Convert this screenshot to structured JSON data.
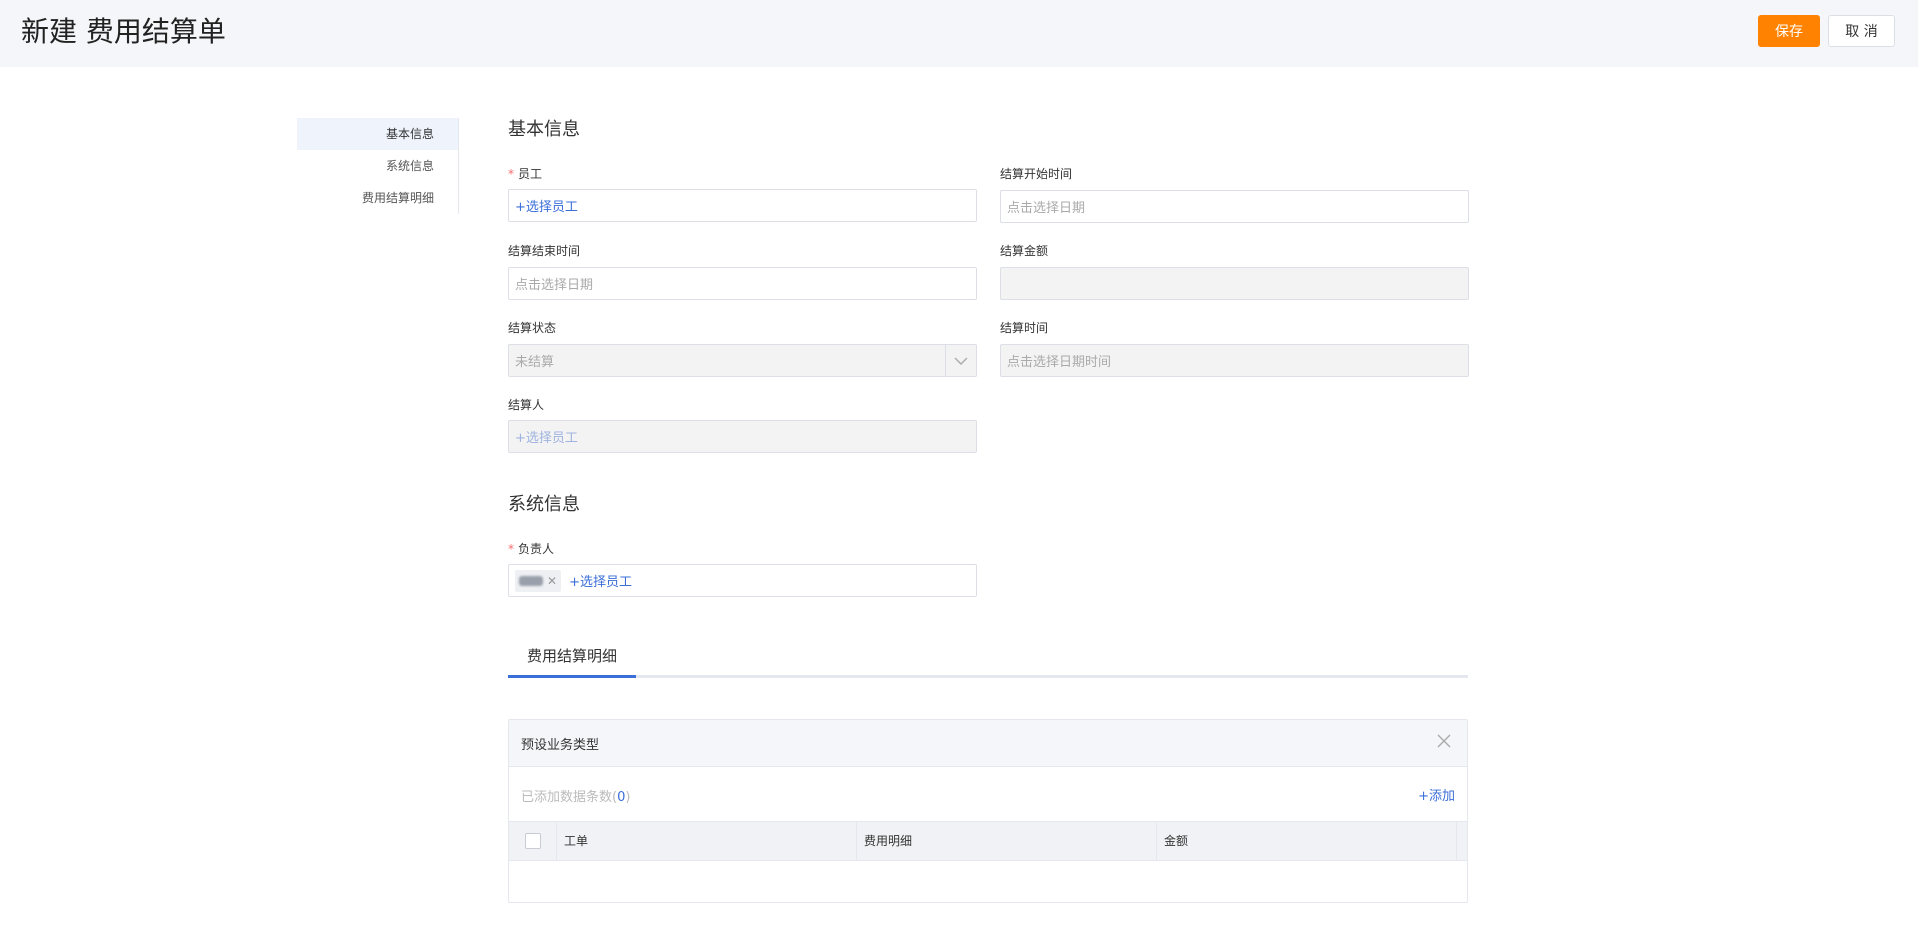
{
  "header": {
    "title": "新建 费用结算单",
    "save_label": "保存",
    "cancel_label": "取 消"
  },
  "nav": {
    "items": [
      "基本信息",
      "系统信息",
      "费用结算明细"
    ]
  },
  "basic": {
    "title": "基本信息",
    "employee": {
      "label": "员工",
      "action": "+选择员工"
    },
    "start_time": {
      "label": "结算开始时间",
      "placeholder": "点击选择日期"
    },
    "end_time": {
      "label": "结算结束时间",
      "placeholder": "点击选择日期"
    },
    "amount": {
      "label": "结算金额",
      "value": ""
    },
    "status": {
      "label": "结算状态",
      "value": "未结算"
    },
    "settle_time": {
      "label": "结算时间",
      "placeholder": "点击选择日期时间"
    },
    "settler": {
      "label": "结算人",
      "action": "+选择员工"
    }
  },
  "system": {
    "title": "系统信息",
    "owner": {
      "label": "负责人",
      "action": "+选择员工"
    }
  },
  "tabs": {
    "active": "费用结算明细"
  },
  "panel": {
    "title": "预设业务类型",
    "count_prefix": "已添加数据条数(",
    "count": "0",
    "count_suffix": ")",
    "add_label": "+添加",
    "columns": [
      "工单",
      "费用明细",
      "金额"
    ]
  }
}
